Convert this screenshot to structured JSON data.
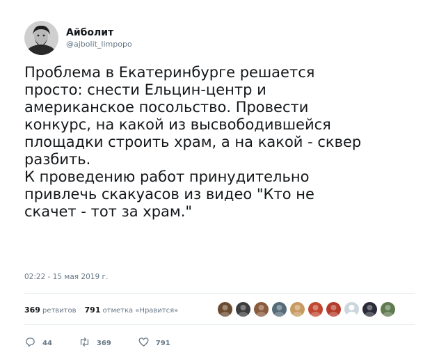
{
  "user": {
    "display_name": "Айболит",
    "handle": "@ajbolit_limpopo"
  },
  "tweet": {
    "lines": [
      "Проблема в Екатеринбурге решается",
      "просто: снести Ельцин-центр и",
      "американское посольство. Провести",
      "конкурс, на какой из высвободившейся",
      "площадки строить храм, а на какой - сквер",
      "разбить.",
      "К проведению работ принудительно",
      "привлечь скакуасов из видео \"Кто не",
      "скачет - тот за храм.\""
    ],
    "timestamp": "02:22 - 15 мая 2019 г."
  },
  "stats": {
    "retweets_count": "369",
    "retweets_label": "ретвитов",
    "likes_count": "791",
    "likes_label": "отметка «Нравится»"
  },
  "actions": {
    "reply_count": "44",
    "retweet_count": "369",
    "like_count": "791"
  },
  "likers": [
    {
      "icon": "liker-avatar",
      "color": "#6b4a2f"
    },
    {
      "icon": "liker-avatar",
      "color": "#3d3d3d"
    },
    {
      "icon": "liker-avatar",
      "color": "#8a5a3c"
    },
    {
      "icon": "liker-avatar",
      "color": "#556b78"
    },
    {
      "icon": "liker-avatar",
      "color": "#c79a62"
    },
    {
      "icon": "liker-avatar",
      "color": "#c0472f"
    },
    {
      "icon": "liker-avatar",
      "color": "#b33b2a"
    },
    {
      "icon": "default-avatar",
      "color": "#ccd6dd"
    },
    {
      "icon": "liker-avatar",
      "color": "#2b2b3a"
    },
    {
      "icon": "liker-avatar",
      "color": "#5f7a4f"
    }
  ],
  "colors": {
    "secondary": "#657786",
    "text": "#14171a",
    "divider": "#e6ecf0"
  }
}
